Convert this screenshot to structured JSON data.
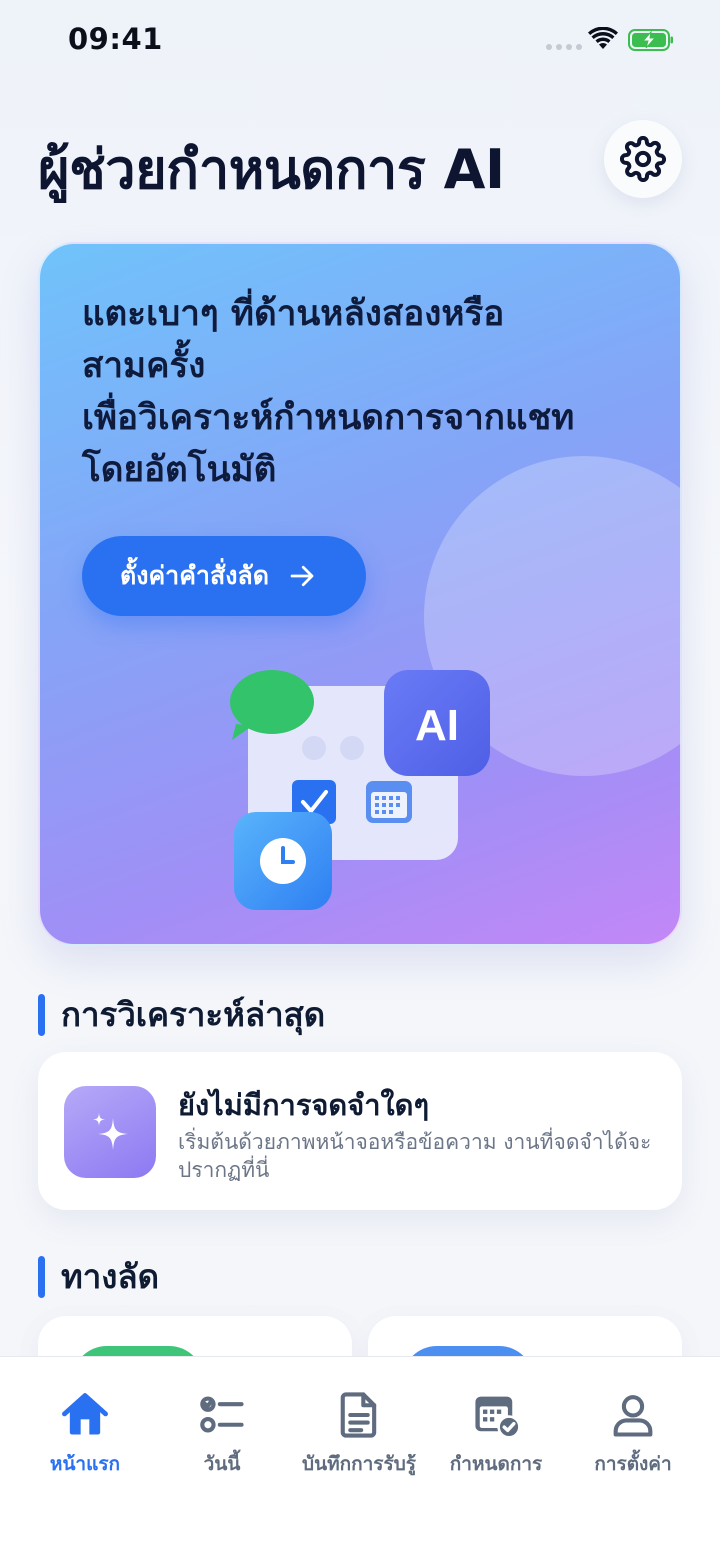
{
  "status_bar": {
    "time": "09:41"
  },
  "header": {
    "title": "ผู้ช่วยกำหนดการ AI",
    "settings_icon": "gear-icon"
  },
  "hero": {
    "lines": [
      "แตะเบาๆ ที่ด้านหลังสองหรือ",
      "สามครั้ง",
      "เพื่อวิเคราะห์กำหนดการจากแชท",
      "โดยอัตโนมัติ"
    ],
    "button_label": "ตั้งค่าคำสั่งลัด",
    "badge_label": "AI"
  },
  "recent": {
    "heading": "การวิเคราะห์ล่าสุด",
    "empty_title": "ยังไม่มีการจดจำใดๆ",
    "empty_desc": "เริ่มต้นด้วยภาพหน้าจอหรือข้อความ งานที่จดจำได้จะปรากฏที่นี่",
    "empty_icon": "sparkles-icon"
  },
  "shortcuts": {
    "heading": "ทางลัด"
  },
  "tab_bar": {
    "tabs": [
      {
        "label": "หน้าแรก",
        "icon": "home-icon",
        "active": true
      },
      {
        "label": "วันนี้",
        "icon": "checklist-icon",
        "active": false
      },
      {
        "label": "บันทึกการรับรู้",
        "icon": "document-icon",
        "active": false
      },
      {
        "label": "กำหนดการ",
        "icon": "calendar-check-icon",
        "active": false
      },
      {
        "label": "การตั้งค่า",
        "icon": "person-icon",
        "active": false
      }
    ]
  },
  "colors": {
    "accent": "#2a71f1",
    "text_primary": "#0f1b33",
    "text_secondary": "#6c7688"
  }
}
